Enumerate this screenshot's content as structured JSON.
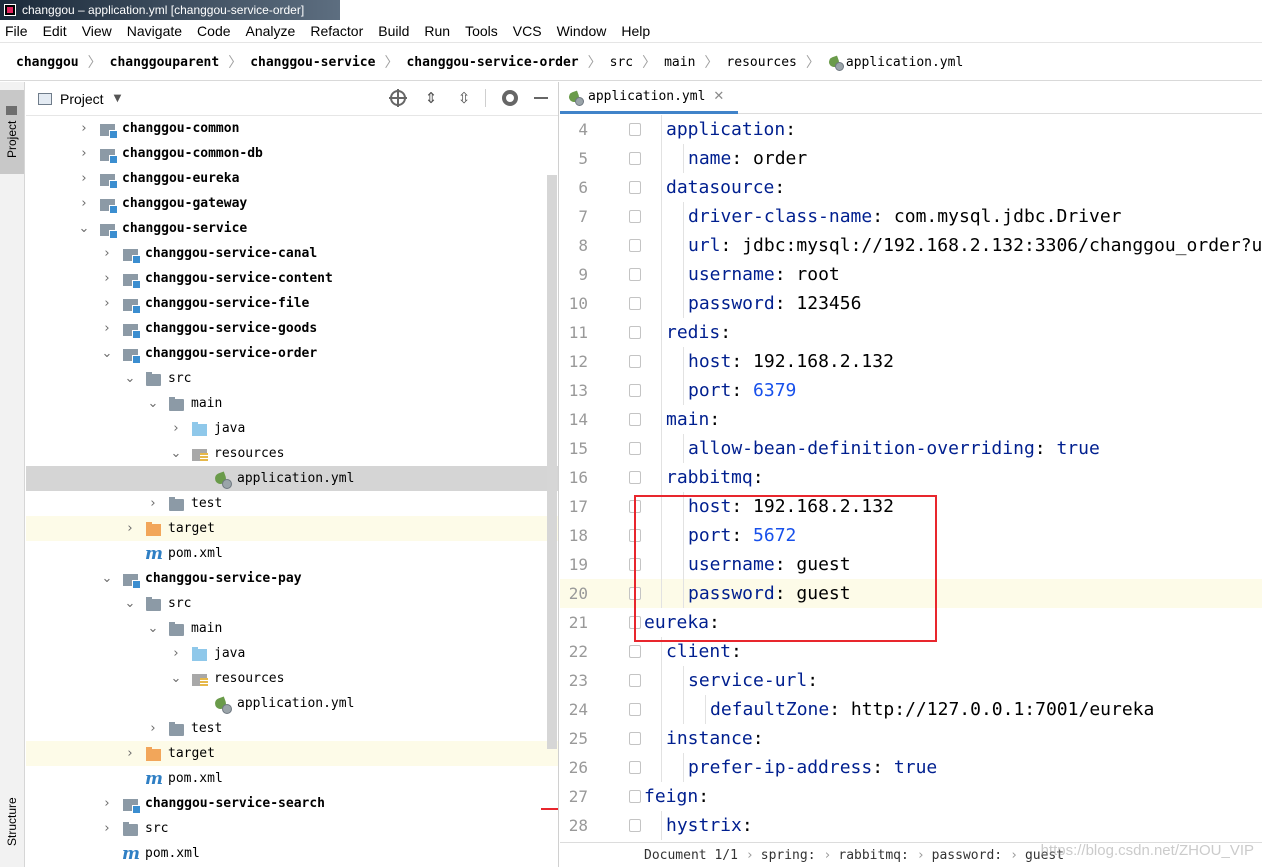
{
  "window": {
    "title": "changgou – application.yml [changgou-service-order]"
  },
  "menu": [
    "File",
    "Edit",
    "View",
    "Navigate",
    "Code",
    "Analyze",
    "Refactor",
    "Build",
    "Run",
    "Tools",
    "VCS",
    "Window",
    "Help"
  ],
  "breadcrumb": [
    "changgou",
    "changgouparent",
    "changgou-service",
    "changgou-service-order",
    "src",
    "main",
    "resources",
    "application.yml"
  ],
  "left_stripe": {
    "project": "Project",
    "structure": "Structure"
  },
  "project_panel": {
    "title": "Project",
    "tree": [
      {
        "label": "changgou-common",
        "arrow": "›",
        "icon": "module",
        "bold": true,
        "indent": 1
      },
      {
        "label": "changgou-common-db",
        "arrow": "›",
        "icon": "module",
        "bold": true,
        "indent": 1
      },
      {
        "label": "changgou-eureka",
        "arrow": "›",
        "icon": "module",
        "bold": true,
        "indent": 1
      },
      {
        "label": "changgou-gateway",
        "arrow": "›",
        "icon": "module",
        "bold": true,
        "indent": 1
      },
      {
        "label": "changgou-service",
        "arrow": "⌄",
        "icon": "module",
        "bold": true,
        "indent": 1
      },
      {
        "label": "changgou-service-canal",
        "arrow": "›",
        "icon": "module",
        "bold": true,
        "indent": 2
      },
      {
        "label": "changgou-service-content",
        "arrow": "›",
        "icon": "module",
        "bold": true,
        "indent": 2
      },
      {
        "label": "changgou-service-file",
        "arrow": "›",
        "icon": "module",
        "bold": true,
        "indent": 2
      },
      {
        "label": "changgou-service-goods",
        "arrow": "›",
        "icon": "module",
        "bold": true,
        "indent": 2
      },
      {
        "label": "changgou-service-order",
        "arrow": "⌄",
        "icon": "module",
        "bold": true,
        "indent": 2
      },
      {
        "label": "src",
        "arrow": "⌄",
        "icon": "folder",
        "bold": false,
        "indent": 3
      },
      {
        "label": "main",
        "arrow": "⌄",
        "icon": "folder",
        "bold": false,
        "indent": 4
      },
      {
        "label": "java",
        "arrow": "›",
        "icon": "src-folder",
        "bold": false,
        "indent": 5
      },
      {
        "label": "resources",
        "arrow": "⌄",
        "icon": "res-folder",
        "bold": false,
        "indent": 5
      },
      {
        "label": "application.yml",
        "arrow": "",
        "icon": "yml",
        "bold": false,
        "indent": 6,
        "selected": true
      },
      {
        "label": "test",
        "arrow": "›",
        "icon": "folder",
        "bold": false,
        "indent": 4
      },
      {
        "label": "target",
        "arrow": "›",
        "icon": "target-folder",
        "bold": false,
        "indent": 3,
        "excluded": true
      },
      {
        "label": "pom.xml",
        "arrow": "",
        "icon": "pom",
        "bold": false,
        "indent": 3
      },
      {
        "label": "changgou-service-pay",
        "arrow": "⌄",
        "icon": "module",
        "bold": true,
        "indent": 2
      },
      {
        "label": "src",
        "arrow": "⌄",
        "icon": "folder",
        "bold": false,
        "indent": 3
      },
      {
        "label": "main",
        "arrow": "⌄",
        "icon": "folder",
        "bold": false,
        "indent": 4
      },
      {
        "label": "java",
        "arrow": "›",
        "icon": "src-folder",
        "bold": false,
        "indent": 5
      },
      {
        "label": "resources",
        "arrow": "⌄",
        "icon": "res-folder",
        "bold": false,
        "indent": 5
      },
      {
        "label": "application.yml",
        "arrow": "",
        "icon": "yml",
        "bold": false,
        "indent": 6
      },
      {
        "label": "test",
        "arrow": "›",
        "icon": "folder",
        "bold": false,
        "indent": 4
      },
      {
        "label": "target",
        "arrow": "›",
        "icon": "target-folder",
        "bold": false,
        "indent": 3,
        "excluded": true
      },
      {
        "label": "pom.xml",
        "arrow": "",
        "icon": "pom",
        "bold": false,
        "indent": 3
      },
      {
        "label": "changgou-service-search",
        "arrow": "›",
        "icon": "module",
        "bold": true,
        "indent": 2
      },
      {
        "label": "src",
        "arrow": "›",
        "icon": "folder",
        "bold": false,
        "indent": 2
      },
      {
        "label": "pom.xml",
        "arrow": "",
        "icon": "pom",
        "bold": false,
        "indent": 2
      }
    ]
  },
  "editor": {
    "tab_label": "application.yml",
    "lines": [
      {
        "n": "4",
        "indent": 1,
        "key": "application",
        "sep": ":",
        "value": "",
        "value_type": ""
      },
      {
        "n": "5",
        "indent": 2,
        "key": "name",
        "sep": ": ",
        "value": "order",
        "value_type": "str"
      },
      {
        "n": "6",
        "indent": 1,
        "key": "datasource",
        "sep": ":",
        "value": "",
        "value_type": ""
      },
      {
        "n": "7",
        "indent": 2,
        "key": "driver-class-name",
        "sep": ": ",
        "value": "com.mysql.jdbc.Driver",
        "value_type": "str"
      },
      {
        "n": "8",
        "indent": 2,
        "key": "url",
        "sep": ": ",
        "value": "jdbc:mysql://192.168.2.132:3306/changgou_order?u",
        "value_type": "str"
      },
      {
        "n": "9",
        "indent": 2,
        "key": "username",
        "sep": ": ",
        "value": "root",
        "value_type": "str"
      },
      {
        "n": "10",
        "indent": 2,
        "key": "password",
        "sep": ": ",
        "value": "123456",
        "value_type": "str"
      },
      {
        "n": "11",
        "indent": 1,
        "key": "redis",
        "sep": ":",
        "value": "",
        "value_type": ""
      },
      {
        "n": "12",
        "indent": 2,
        "key": "host",
        "sep": ": ",
        "value": "192.168.2.132",
        "value_type": "str"
      },
      {
        "n": "13",
        "indent": 2,
        "key": "port",
        "sep": ": ",
        "value": "6379",
        "value_type": "num"
      },
      {
        "n": "14",
        "indent": 1,
        "key": "main",
        "sep": ":",
        "value": "",
        "value_type": ""
      },
      {
        "n": "15",
        "indent": 2,
        "key": "allow-bean-definition-overriding",
        "sep": ": ",
        "value": "true",
        "value_type": "kw"
      },
      {
        "n": "16",
        "indent": 1,
        "key": "rabbitmq",
        "sep": ":",
        "value": "",
        "value_type": ""
      },
      {
        "n": "17",
        "indent": 2,
        "key": "host",
        "sep": ": ",
        "value": "192.168.2.132",
        "value_type": "str"
      },
      {
        "n": "18",
        "indent": 2,
        "key": "port",
        "sep": ": ",
        "value": "5672",
        "value_type": "num"
      },
      {
        "n": "19",
        "indent": 2,
        "key": "username",
        "sep": ": ",
        "value": "guest",
        "value_type": "str"
      },
      {
        "n": "20",
        "indent": 2,
        "key": "password",
        "sep": ": ",
        "value": "guest",
        "value_type": "str",
        "caret": true
      },
      {
        "n": "21",
        "indent": 0,
        "key": "eureka",
        "sep": ":",
        "value": "",
        "value_type": ""
      },
      {
        "n": "22",
        "indent": 1,
        "key": "client",
        "sep": ":",
        "value": "",
        "value_type": ""
      },
      {
        "n": "23",
        "indent": 2,
        "key": "service-url",
        "sep": ":",
        "value": "",
        "value_type": ""
      },
      {
        "n": "24",
        "indent": 3,
        "key": "defaultZone",
        "sep": ": ",
        "value": "http://127.0.0.1:7001/eureka",
        "value_type": "str"
      },
      {
        "n": "25",
        "indent": 1,
        "key": "instance",
        "sep": ":",
        "value": "",
        "value_type": ""
      },
      {
        "n": "26",
        "indent": 2,
        "key": "prefer-ip-address",
        "sep": ": ",
        "value": "true",
        "value_type": "kw"
      },
      {
        "n": "27",
        "indent": 0,
        "key": "feign",
        "sep": ":",
        "value": "",
        "value_type": ""
      },
      {
        "n": "28",
        "indent": 1,
        "key": "hystrix",
        "sep": ":",
        "value": "",
        "value_type": ""
      }
    ]
  },
  "status": {
    "path": [
      "Document 1/1",
      "spring:",
      "rabbitmq:",
      "password:",
      "guest"
    ]
  },
  "watermark": "https://blog.csdn.net/ZHOU_VIP",
  "colors": {
    "highlight_box": "#e8262d",
    "key": "#001f8f",
    "number": "#1750eb",
    "tab_underline": "#4083c9"
  }
}
